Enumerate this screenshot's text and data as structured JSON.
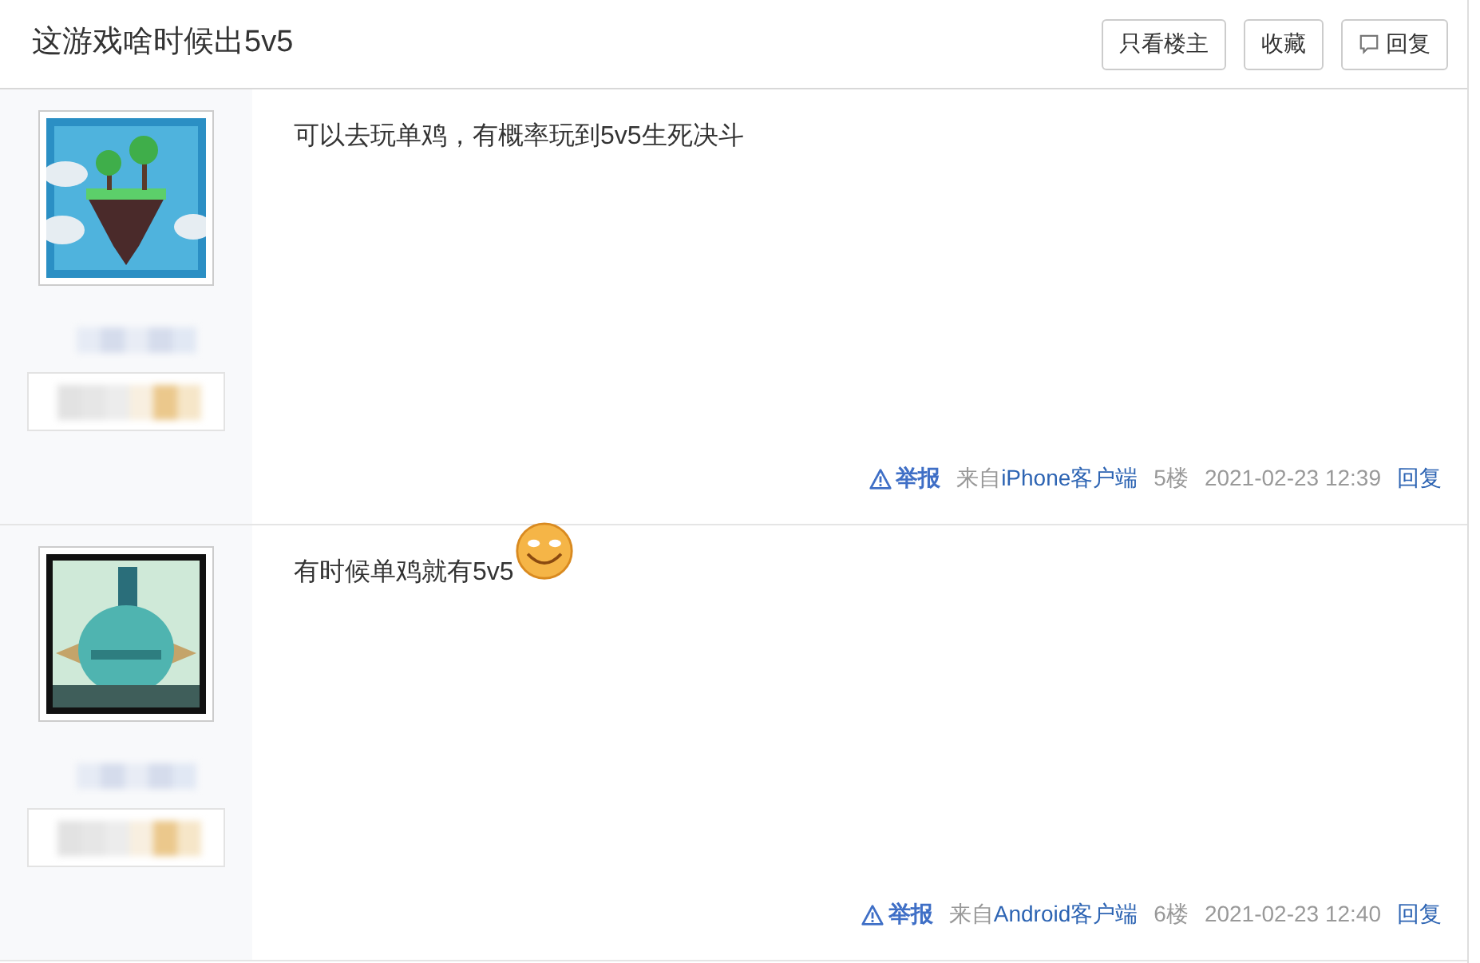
{
  "thread": {
    "title": "这游戏啥时候出5v5",
    "buttons": [
      {
        "kind": "plain",
        "label": "只看楼主"
      },
      {
        "kind": "plain",
        "label": "收藏"
      },
      {
        "kind": "reply",
        "label": "回复"
      }
    ]
  },
  "posts": [
    {
      "content": "可以去玩单鸡，有概率玩到5v5生死决斗",
      "emoticon": false,
      "report": "举报",
      "source_prefix": "来自",
      "source": "iPhone客户端",
      "floor": "5楼",
      "time": "2021-02-23 12:39",
      "reply": "回复"
    },
    {
      "content": "有时候单鸡就有5v5",
      "emoticon": true,
      "report": "举报",
      "source_prefix": "来自",
      "source": "Android客户端",
      "floor": "6楼",
      "time": "2021-02-23 12:40",
      "reply": "回复"
    }
  ]
}
